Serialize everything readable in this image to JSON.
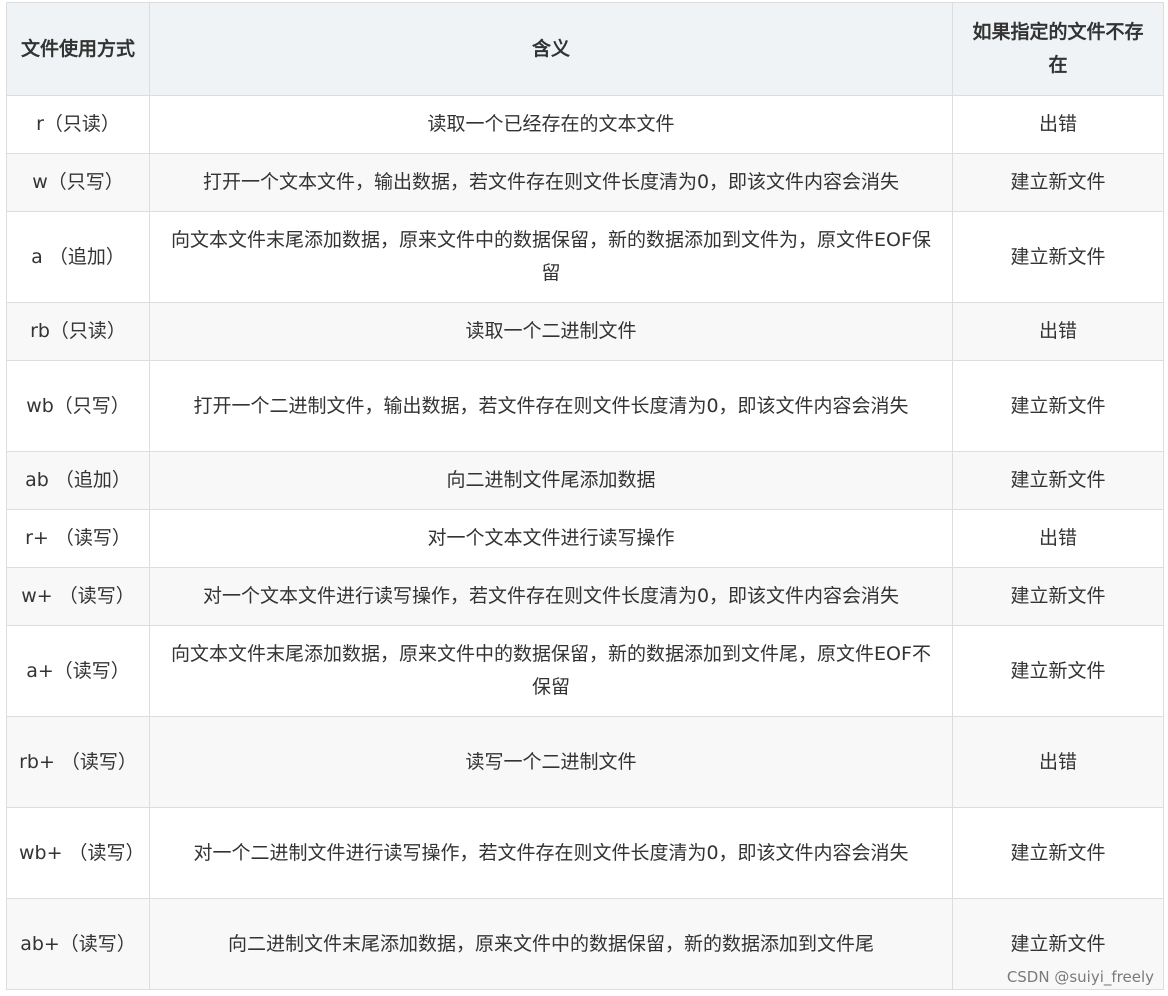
{
  "table": {
    "headers": [
      "文件使用方式",
      "含义",
      "如果指定的文件不存在"
    ],
    "rows": [
      [
        "r（只读）",
        "读取一个已经存在的文本文件",
        "出错"
      ],
      [
        "w（只写）",
        "打开一个文本文件，输出数据，若文件存在则文件长度清为0，即该文件内容会消失",
        "建立新文件"
      ],
      [
        "a （追加）",
        "向文本文件末尾添加数据，原来文件中的数据保留，新的数据添加到文件为，原文件EOF保留",
        "建立新文件"
      ],
      [
        "rb（只读）",
        "读取一个二进制文件",
        "出错"
      ],
      [
        "wb（只写）",
        "打开一个二进制文件，输出数据，若文件存在则文件长度清为0，即该文件内容会消失",
        "建立新文件"
      ],
      [
        "ab （追加）",
        "向二进制文件尾添加数据",
        "建立新文件"
      ],
      [
        "r+ （读写）",
        "对一个文本文件进行读写操作",
        "出错"
      ],
      [
        "w+ （读写）",
        "对一个文本文件进行读写操作，若文件存在则文件长度清为0，即该文件内容会消失",
        "建立新文件"
      ],
      [
        "a+（读写）",
        "向文本文件末尾添加数据，原来文件中的数据保留，新的数据添加到文件尾，原文件EOF不保留",
        "建立新文件"
      ],
      [
        "rb+ （读写）",
        "读写一个二进制文件",
        "出错"
      ],
      [
        "wb+ （读写）",
        "对一个二进制文件进行读写操作，若文件存在则文件长度清为0，即该文件内容会消失",
        "建立新文件"
      ],
      [
        "ab+（读写）",
        "向二进制文件末尾添加数据，原来文件中的数据保留，新的数据添加到文件尾",
        "建立新文件"
      ]
    ]
  },
  "watermark": "CSDN @suiyi_freely"
}
